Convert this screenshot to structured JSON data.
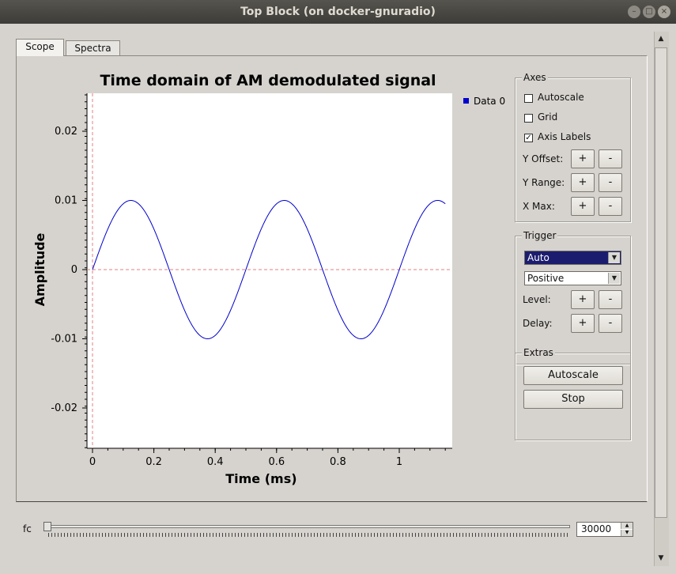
{
  "window": {
    "title": "Top Block (on docker-gnuradio)"
  },
  "tabs": [
    {
      "label": "Scope",
      "active": true
    },
    {
      "label": "Spectra",
      "active": false
    }
  ],
  "chart_data": {
    "type": "line",
    "title": "Time domain of AM demodulated signal",
    "xlabel": "Time (ms)",
    "ylabel": "Amplitude",
    "xlim": [
      0,
      1.16
    ],
    "ylim": [
      -0.025,
      0.025
    ],
    "xticks": [
      "0",
      "0.2",
      "0.4",
      "0.6",
      "0.8",
      "1"
    ],
    "yticks": [
      "0.02",
      "0.01",
      "0",
      "-0.01",
      "-0.02"
    ],
    "legend": "top-right",
    "grid": false,
    "series": [
      {
        "name": "Data 0",
        "color": "#0000cc",
        "function": "sine",
        "amplitude": 0.01,
        "period_ms": 0.5,
        "x_start": 0,
        "x_end": 1.15
      }
    ]
  },
  "axes": {
    "title": "Axes",
    "autoscale": {
      "label": "Autoscale",
      "checked": false
    },
    "grid": {
      "label": "Grid",
      "checked": false
    },
    "axis_labels": {
      "label": "Axis Labels",
      "checked": true
    },
    "y_offset": "Y Offset:",
    "y_range": "Y Range:",
    "x_max": "X Max:",
    "plus": "+",
    "minus": "-"
  },
  "trigger": {
    "title": "Trigger",
    "mode": "Auto",
    "slope": "Positive",
    "level": "Level:",
    "delay": "Delay:"
  },
  "extras": {
    "title": "Extras",
    "autoscale": "Autoscale",
    "stop": "Stop"
  },
  "slider": {
    "label": "fc",
    "value": "30000"
  }
}
